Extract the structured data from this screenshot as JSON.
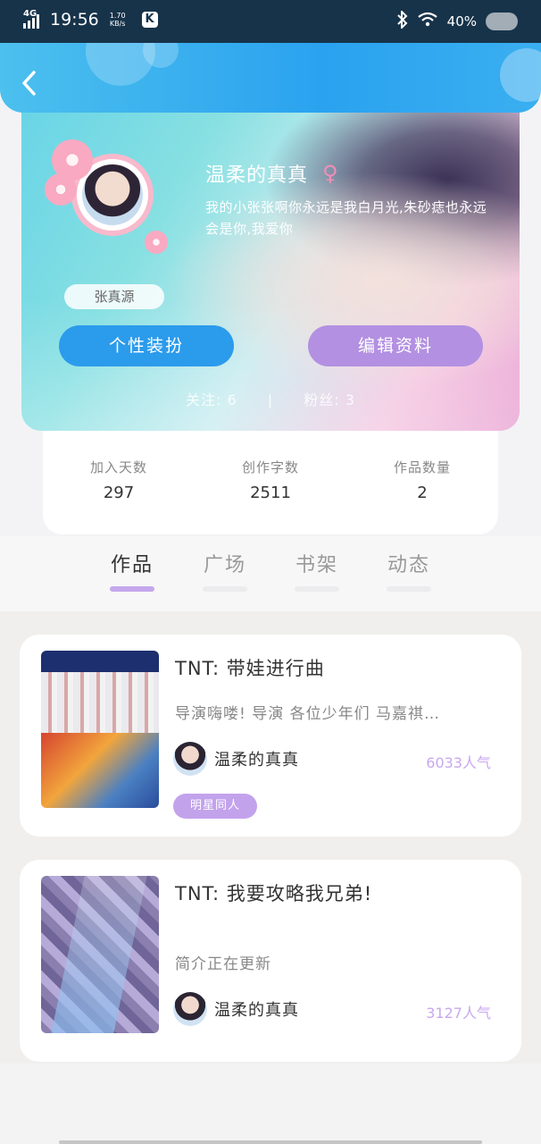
{
  "status_bar": {
    "network": "4G",
    "time": "19:56",
    "speed_value": "1.70",
    "speed_unit": "KB/s",
    "app_badge": "K",
    "battery": "40%"
  },
  "profile": {
    "nickname": "温柔的真真",
    "signature": "我的小张张啊你永远是我白月光,朱砂痣也永远会是你,我爱你",
    "name_tag": "张真源",
    "decorate_button": "个性装扮",
    "edit_button": "编辑资料",
    "following": "关注: 6",
    "separator": "|",
    "fans": "粉丝: 3"
  },
  "stats": [
    {
      "label": "加入天数",
      "value": "297"
    },
    {
      "label": "创作字数",
      "value": "2511"
    },
    {
      "label": "作品数量",
      "value": "2"
    }
  ],
  "tabs": [
    {
      "label": "作品",
      "active": true
    },
    {
      "label": "广场",
      "active": false
    },
    {
      "label": "书架",
      "active": false
    },
    {
      "label": "动态",
      "active": false
    }
  ],
  "works": [
    {
      "title": "TNT: 带娃进行曲",
      "description": "导演嗨喽! 导演 各位少年们 马嘉祺…",
      "author": "温柔的真真",
      "popularity": "6033人气",
      "tag": "明星同人"
    },
    {
      "title": "TNT: 我要攻略我兄弟!",
      "description": "简介正在更新",
      "author": "温柔的真真",
      "popularity": "3127人气"
    }
  ],
  "colors": {
    "header": "#2aa2ef",
    "accent_blue": "#2b9bec",
    "accent_purple": "#b390e2",
    "popularity": "#c8a8ef"
  }
}
